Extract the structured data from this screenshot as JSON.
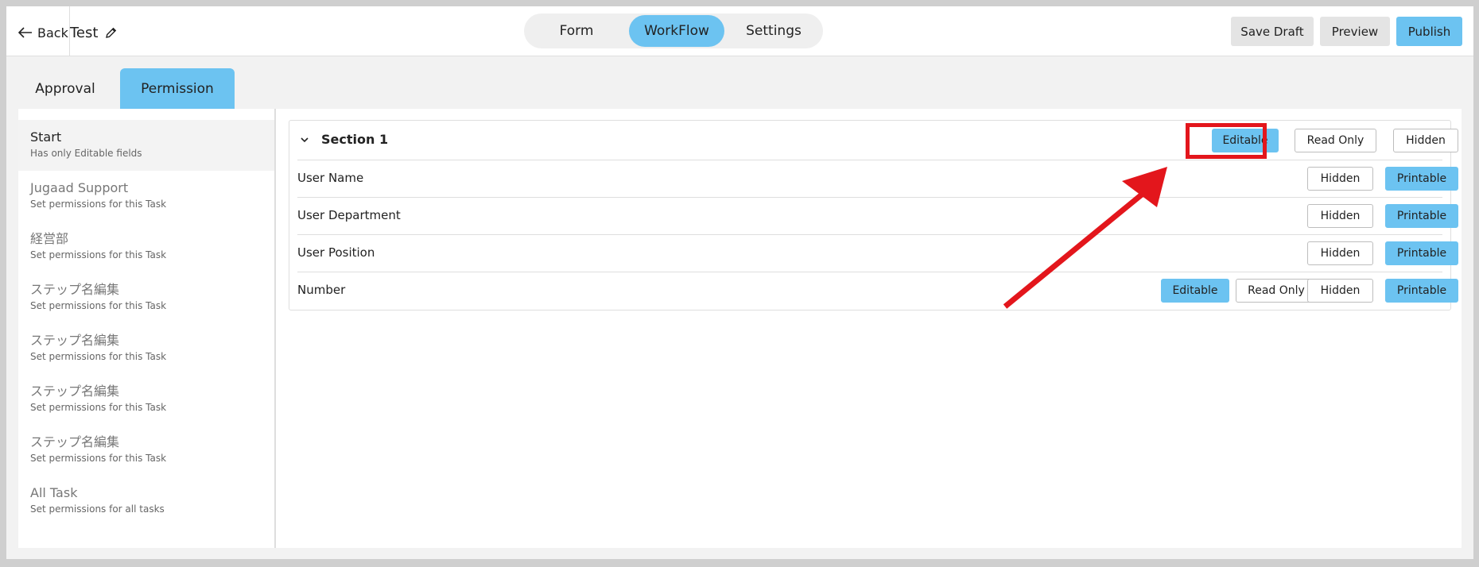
{
  "header": {
    "back_label": "Back",
    "title": "Test",
    "tabs": [
      {
        "label": "Form",
        "active": false
      },
      {
        "label": "WorkFlow",
        "active": true
      },
      {
        "label": "Settings",
        "active": false
      }
    ],
    "save_draft_label": "Save Draft",
    "preview_label": "Preview",
    "publish_label": "Publish"
  },
  "sub_tabs": [
    {
      "label": "Approval",
      "active": false
    },
    {
      "label": "Permission",
      "active": true
    }
  ],
  "sidebar": {
    "items": [
      {
        "name": "Start",
        "desc": "Has only Editable fields",
        "active": true
      },
      {
        "name": "Jugaad Support",
        "desc": "Set permissions for this Task",
        "active": false
      },
      {
        "name": "経営部",
        "desc": "Set permissions for this Task",
        "active": false
      },
      {
        "name": "ステップ名編集",
        "desc": "Set permissions for this Task",
        "active": false
      },
      {
        "name": "ステップ名編集",
        "desc": "Set permissions for this Task",
        "active": false
      },
      {
        "name": "ステップ名編集",
        "desc": "Set permissions for this Task",
        "active": false
      },
      {
        "name": "ステップ名編集",
        "desc": "Set permissions for this Task",
        "active": false
      },
      {
        "name": "All Task",
        "desc": "Set permissions for all tasks",
        "active": false
      }
    ]
  },
  "section": {
    "title": "Section 1",
    "buttons": {
      "editable": "Editable",
      "read_only": "Read Only",
      "hidden": "Hidden"
    },
    "rows": [
      {
        "label": "User Name",
        "hidden": "Hidden",
        "printable": "Printable"
      },
      {
        "label": "User Department",
        "hidden": "Hidden",
        "printable": "Printable"
      },
      {
        "label": "User Position",
        "hidden": "Hidden",
        "printable": "Printable"
      },
      {
        "label": "Number",
        "editable": "Editable",
        "read_only": "Read Only",
        "hidden": "Hidden",
        "printable": "Printable"
      }
    ]
  },
  "colors": {
    "accent": "#6cc3f1",
    "annotation": "#e3161c"
  },
  "icons": {
    "back": "arrow-left-icon",
    "edit": "pencil-icon",
    "collapse": "chevron-down-icon"
  }
}
